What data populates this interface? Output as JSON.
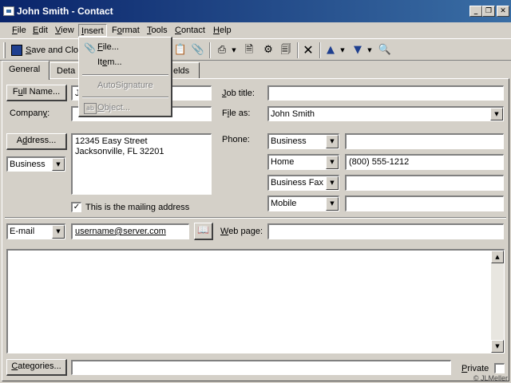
{
  "window": {
    "title": "John Smith - Contact",
    "minimize_glyph": "_",
    "maximize_glyph": "❐",
    "close_glyph": "✕"
  },
  "menubar": {
    "items": [
      {
        "pre": "",
        "u": "F",
        "post": "ile"
      },
      {
        "pre": "",
        "u": "E",
        "post": "dit"
      },
      {
        "pre": "",
        "u": "V",
        "post": "iew"
      },
      {
        "pre": "",
        "u": "I",
        "post": "nsert"
      },
      {
        "pre": "F",
        "u": "o",
        "post": "rmat"
      },
      {
        "pre": "",
        "u": "T",
        "post": "ools"
      },
      {
        "pre": "",
        "u": "C",
        "post": "ontact"
      },
      {
        "pre": "",
        "u": "H",
        "post": "elp"
      }
    ]
  },
  "toolbar": {
    "save_close_pre": "",
    "save_close_u": "S",
    "save_close_post": "ave and Clo"
  },
  "insert_menu": {
    "file": {
      "u": "F",
      "post": "ile..."
    },
    "item": {
      "pre": "It",
      "u": "e",
      "post": "m..."
    },
    "autosignature": "AutoSignature",
    "object": {
      "u": "O",
      "post": "bject..."
    }
  },
  "tabs": {
    "general": "General",
    "details": "Deta",
    "fields": "elds"
  },
  "general": {
    "full_name_button": {
      "pre": "F",
      "u": "u",
      "post": "ll Name..."
    },
    "full_name_value": "J",
    "company_label": {
      "pre": "Compan",
      "u": "y",
      "post": ":"
    },
    "company_value": "",
    "job_title_label": {
      "pre": "",
      "u": "J",
      "post": "ob title:"
    },
    "job_title_value": "",
    "file_as_label": {
      "pre": "F",
      "u": "i",
      "post": "le as:"
    },
    "file_as_value": "John Smith",
    "address_button": {
      "pre": "A",
      "u": "d",
      "post": "dress..."
    },
    "address_type": "Business",
    "address_lines": [
      "12345 Easy Street",
      "Jacksonville, FL  32201"
    ],
    "mailing_checkbox_checked": true,
    "mailing_label": "This is the mailing address",
    "phone_label": "Phone:",
    "phones": [
      {
        "type": "Business",
        "value": ""
      },
      {
        "type": "Home",
        "value": "(800) 555-1212"
      },
      {
        "type": "Business Fax",
        "value": ""
      },
      {
        "type": "Mobile",
        "value": ""
      }
    ],
    "email_type": "E-mail",
    "email_value": "username@server.com",
    "web_page_label": {
      "pre": "",
      "u": "W",
      "post": "eb page:"
    },
    "web_page_value": "",
    "notes_value": "",
    "categories_button": {
      "pre": "",
      "u": "C",
      "post": "ategories..."
    },
    "categories_value": "",
    "private_label": {
      "pre": "",
      "u": "P",
      "post": "rivate"
    },
    "private_checked": false,
    "copyright": "© JLMeller"
  },
  "icons": {
    "arrow_down": "▼",
    "arrow_up": "▲",
    "checkmark": "✓"
  }
}
